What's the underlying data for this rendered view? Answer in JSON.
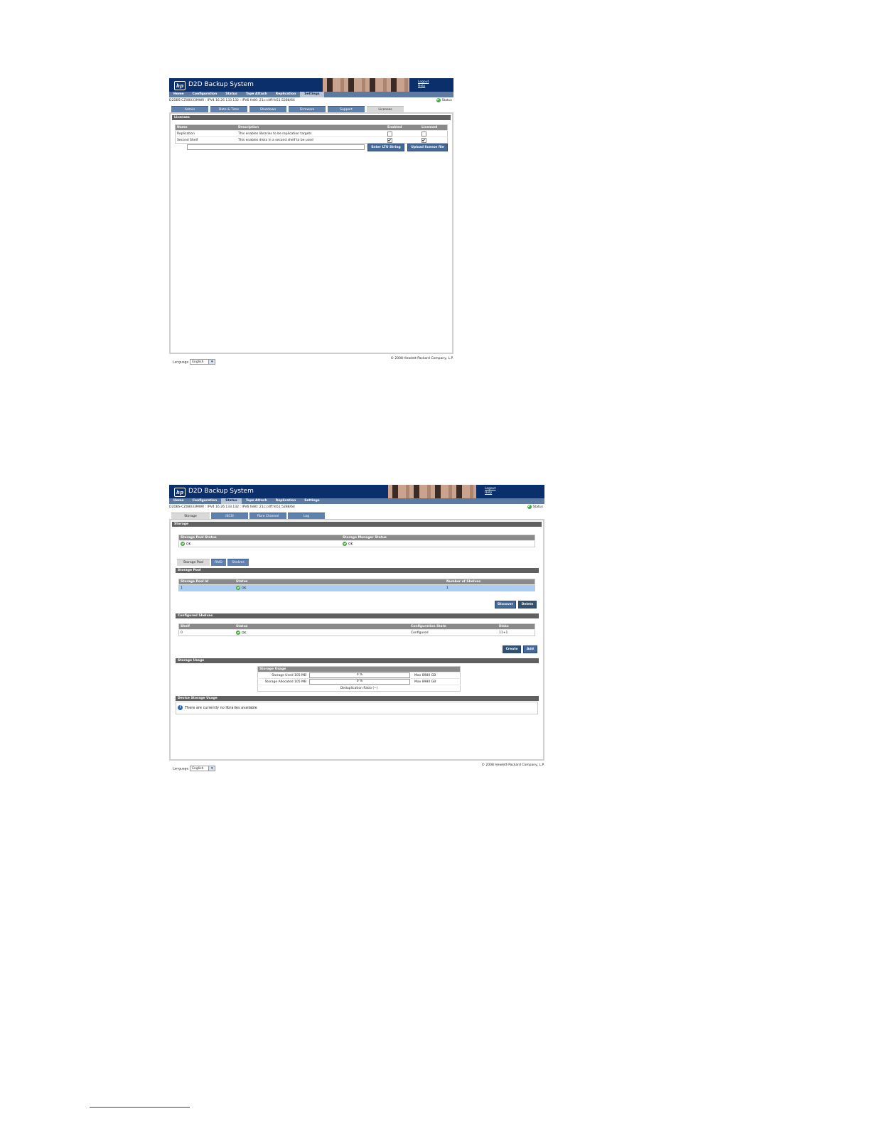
{
  "app": {
    "title": "D2D Backup System",
    "logo_text": "hp",
    "logout": "Logout",
    "help": "Help",
    "status": "Status",
    "language_label": "Language",
    "language_value": "English",
    "copyright": "© 2008 Hewlett-Packard Company, L.P."
  },
  "nav": [
    "Home",
    "Configuration",
    "Status",
    "Tape Attach",
    "Replication",
    "Settings"
  ],
  "ip_line": "D2DBS-CZ08033MWR : IPV4 16.26.133.132 : IPV6 fe80::21c:c4ff:fe51:5288/64",
  "licenses_page": {
    "active_nav": "Settings",
    "tabs": [
      "Admin",
      "Date & Time",
      "Shutdown",
      "Firmware",
      "Support",
      "Licenses"
    ],
    "active_tab": "Licenses",
    "section": "Licenses",
    "columns": [
      "Name",
      "Description",
      "Enabled",
      "Licensed"
    ],
    "rows": [
      {
        "name": "Replication",
        "description": "This enables libraries to be replication targets",
        "enabled": false,
        "licensed": false
      },
      {
        "name": "Second Shelf",
        "description": "This enables disks in a second shelf to be used",
        "enabled": true,
        "licensed": true
      }
    ],
    "lts_input_value": "",
    "enter_button": "Enter LTU String",
    "upload_button": "Upload license file"
  },
  "storage_page": {
    "active_nav": "Status",
    "tabs": [
      "Storage",
      "iSCSI",
      "Fibre Channel",
      "Log"
    ],
    "active_tab": "Storage",
    "section": "Storage",
    "status_table": {
      "columns": [
        "Storage Pool Status",
        "Storage Manager Status"
      ],
      "values": [
        "OK",
        "OK"
      ]
    },
    "subtabs": [
      "Storage Pool",
      "RAID",
      "Shelves"
    ],
    "active_subtab": "Storage Pool",
    "pool_section": "Storage Pool",
    "pool_columns": [
      "Storage Pool Id",
      "Status",
      "Number of Shelves"
    ],
    "pool_row": {
      "id": "1",
      "status": "OK",
      "shelves": "1"
    },
    "discover_button": "Discover",
    "delete_button": "Delete",
    "shelves_section": "Configured Shelves",
    "shelves_columns": [
      "Shelf",
      "Status",
      "Configuration State",
      "Disks"
    ],
    "shelves_row": {
      "shelf": "0",
      "status": "OK",
      "state": "Configured",
      "disks": "11+1"
    },
    "create_button": "Create",
    "add_button": "Add",
    "usage_section": "Storage Usage",
    "usage_header": "Storage Usage",
    "usage_rows": [
      {
        "label": "Storage Used 105 MB",
        "percent_label": "0 %",
        "percent": 0,
        "max": "Max 8980 GB"
      },
      {
        "label": "Storage Allocated 105 MB",
        "percent_label": "0 %",
        "percent": 0,
        "max": "Max 8980 GB"
      }
    ],
    "dedupe": "Deduplication Ratio (--)",
    "device_section": "Device Storage Usage",
    "device_message": "There are currently no libraries available"
  },
  "colors": {
    "header": "#0b2f6b",
    "nav": "#5c7aa2",
    "tab": "#5e81af",
    "ok": "#47a83f",
    "selected_row": "#a9cdf3"
  }
}
